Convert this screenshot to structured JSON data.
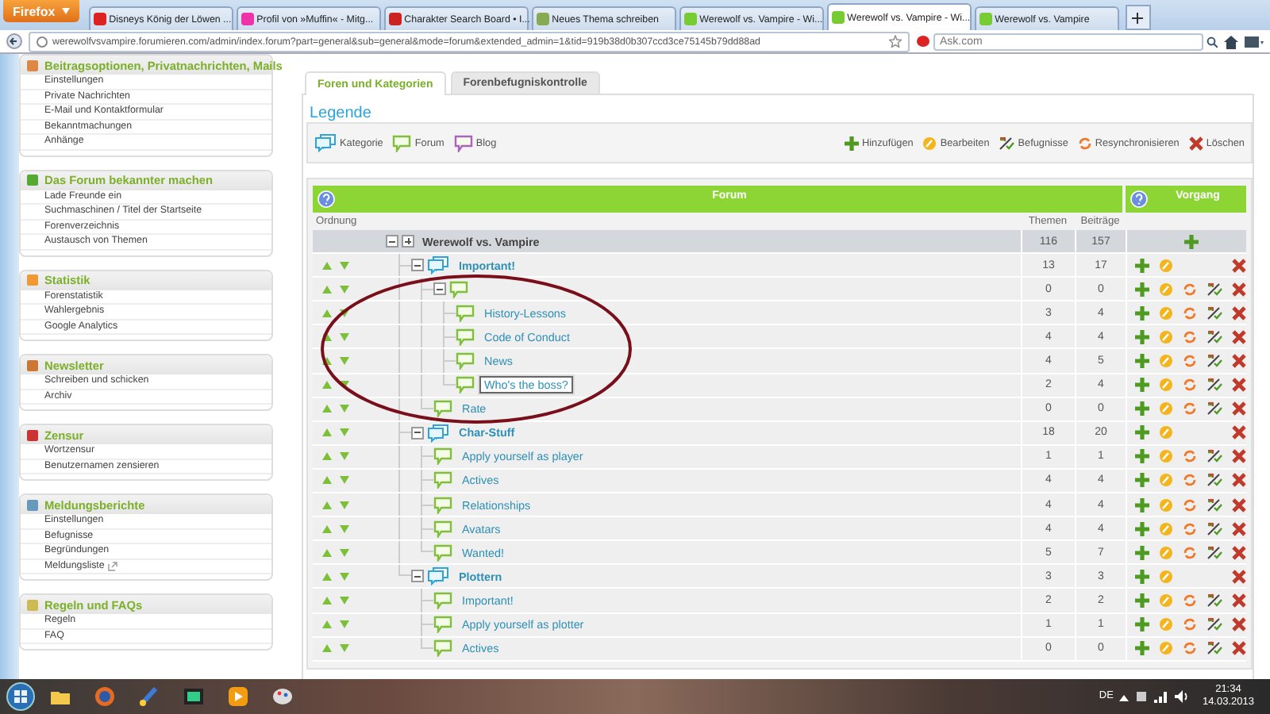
{
  "browser": {
    "menu_button": "Firefox",
    "tabs": [
      {
        "title": "Disneys König der Löwen ...",
        "selected": false
      },
      {
        "title": "Profil von »Muffin« - Mitg...",
        "selected": false
      },
      {
        "title": "Charakter Search Board • I...",
        "selected": false
      },
      {
        "title": "Neues Thema schreiben",
        "selected": false
      },
      {
        "title": "Werewolf vs. Vampire - Wi...",
        "selected": false
      },
      {
        "title": "Werewolf vs. Vampire - Wi...",
        "selected": true
      },
      {
        "title": "Werewolf vs. Vampire",
        "selected": false
      }
    ],
    "url": "werewolfvsvampire.forumieren.com/admin/index.forum?part=general&sub=general&mode=forum&extended_admin=1&tid=919b38d0b307ccd3ce75145b79dd88ad",
    "search": {
      "placeholder": "Ask.com"
    }
  },
  "sidebar": {
    "sections": [
      {
        "title": "Beitragsoptionen, Privatnachrichten, Mails",
        "items": [
          {
            "label": "Einstellungen",
            "external": false
          },
          {
            "label": "Private Nachrichten",
            "external": false
          },
          {
            "label": "E-Mail und Kontaktformular",
            "external": false
          },
          {
            "label": "Bekanntmachungen",
            "external": false
          },
          {
            "label": "Anhänge",
            "external": false
          }
        ]
      },
      {
        "title": "Das Forum bekannter machen",
        "items": [
          {
            "label": "Lade Freunde ein",
            "external": false
          },
          {
            "label": "Suchmaschinen / Titel der Startseite",
            "external": false
          },
          {
            "label": "Forenverzeichnis",
            "external": false
          },
          {
            "label": "Austausch von Themen",
            "external": false
          }
        ]
      },
      {
        "title": "Statistik",
        "items": [
          {
            "label": "Forenstatistik",
            "external": false
          },
          {
            "label": "Wahlergebnis",
            "external": false
          },
          {
            "label": "Google Analytics",
            "external": false
          }
        ]
      },
      {
        "title": "Newsletter",
        "items": [
          {
            "label": "Schreiben und schicken",
            "external": false
          },
          {
            "label": "Archiv",
            "external": false
          }
        ]
      },
      {
        "title": "Zensur",
        "items": [
          {
            "label": "Wortzensur",
            "external": false
          },
          {
            "label": "Benutzernamen zensieren",
            "external": false
          }
        ]
      },
      {
        "title": "Meldungsberichte",
        "items": [
          {
            "label": "Einstellungen",
            "external": false
          },
          {
            "label": "Befugnisse",
            "external": false
          },
          {
            "label": "Begründungen",
            "external": false
          },
          {
            "label": "Meldungsliste",
            "external": true
          }
        ]
      },
      {
        "title": "Regeln und FAQs",
        "items": [
          {
            "label": "Regeln",
            "external": false
          },
          {
            "label": "FAQ",
            "external": false
          }
        ]
      }
    ]
  },
  "tabs": [
    {
      "label": "Foren und Kategorien",
      "selected": true
    },
    {
      "label": "Forenbefugniskontrolle",
      "selected": false
    }
  ],
  "legend": {
    "title": "Legende",
    "types": [
      {
        "kind": "category",
        "label": "Kategorie"
      },
      {
        "kind": "forum",
        "label": "Forum"
      },
      {
        "kind": "blog",
        "label": "Blog"
      }
    ],
    "actions": [
      {
        "kind": "add",
        "label": "Hinzufügen"
      },
      {
        "kind": "edit",
        "label": "Bearbeiten"
      },
      {
        "kind": "permissions",
        "label": "Befugnisse"
      },
      {
        "kind": "resync",
        "label": "Resynchronisieren"
      },
      {
        "kind": "delete",
        "label": "Löschen"
      }
    ]
  },
  "table": {
    "headers": {
      "forum": "Forum",
      "actions": "Vorgang",
      "order": "Ordnung",
      "topics": "Themen",
      "posts": "Beiträge"
    },
    "root": {
      "name": "Werewolf vs. Vampire",
      "topics": "116",
      "posts": "157",
      "expanded": true
    },
    "rows": [
      {
        "kind": "category",
        "name": "Important!",
        "topics": "13",
        "posts": "17",
        "selected": false,
        "expanded": true,
        "children": [
          {
            "kind": "forum",
            "topics": "0",
            "posts": "0",
            "selected": false,
            "expanded": true,
            "children": [
              {
                "kind": "forum",
                "name": "History-Lessons",
                "topics": "3",
                "posts": "4",
                "selected": false
              },
              {
                "kind": "forum",
                "name": "Code of Conduct",
                "topics": "4",
                "posts": "4",
                "selected": false
              },
              {
                "kind": "forum",
                "name": "News",
                "topics": "4",
                "posts": "5",
                "selected": false
              },
              {
                "kind": "forum",
                "name": "Who's the boss?",
                "topics": "2",
                "posts": "4",
                "selected": true
              }
            ]
          },
          {
            "kind": "forum",
            "name": "Rate",
            "topics": "0",
            "posts": "0",
            "selected": false
          }
        ]
      },
      {
        "kind": "category",
        "name": "Char-Stuff",
        "topics": "18",
        "posts": "20",
        "selected": false,
        "expanded": true,
        "children": [
          {
            "kind": "forum",
            "name": "Apply yourself as player",
            "topics": "1",
            "posts": "1",
            "selected": false
          },
          {
            "kind": "forum",
            "name": "Actives",
            "topics": "4",
            "posts": "4",
            "selected": false
          },
          {
            "kind": "forum",
            "name": "Relationships",
            "topics": "4",
            "posts": "4",
            "selected": false
          },
          {
            "kind": "forum",
            "name": "Avatars",
            "topics": "4",
            "posts": "4",
            "selected": false
          },
          {
            "kind": "forum",
            "name": "Wanted!",
            "topics": "5",
            "posts": "7",
            "selected": false
          }
        ]
      },
      {
        "kind": "category",
        "name": "Plottern",
        "topics": "3",
        "posts": "3",
        "selected": false,
        "expanded": true,
        "children": [
          {
            "kind": "forum",
            "name": "Important!",
            "topics": "2",
            "posts": "2",
            "selected": false
          },
          {
            "kind": "forum",
            "name": "Apply yourself as plotter",
            "topics": "1",
            "posts": "1",
            "selected": false
          },
          {
            "kind": "forum",
            "name": "Actives",
            "topics": "0",
            "posts": "0",
            "selected": false
          }
        ]
      }
    ]
  },
  "taskbar": {
    "language": "DE",
    "time": "21:34",
    "date": "14.03.2013"
  }
}
